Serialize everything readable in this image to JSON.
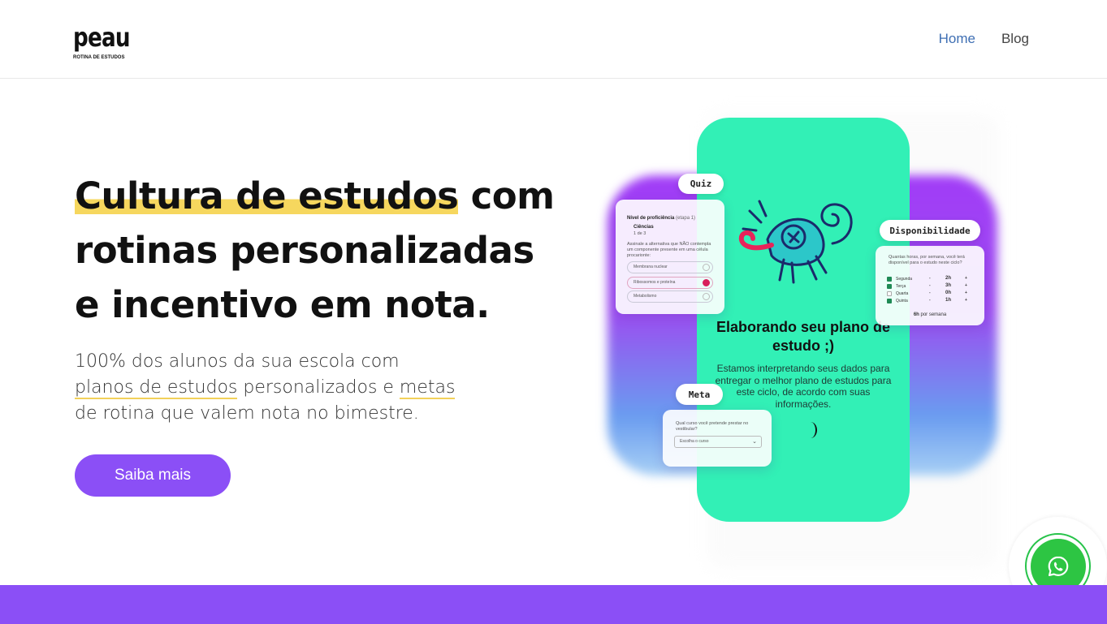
{
  "header": {
    "logo_text": "peau",
    "logo_subtitle": "ROTINA DE ESTUDOS",
    "nav": [
      {
        "label": "Home"
      },
      {
        "label": "Blog"
      }
    ]
  },
  "hero": {
    "headline_highlight": "Cultura de estudos",
    "headline_rest_1": " com",
    "headline_line_2": "rotinas personalizadas",
    "headline_line_3": "e incentivo em nota.",
    "sub_1": "100% dos alunos da sua escola com",
    "sub_link_1": "planos de estudos",
    "sub_2": " personalizados e ",
    "sub_link_2": "metas",
    "sub_3": "de rotina que valem nota no bimestre.",
    "cta_label": "Saiba mais"
  },
  "illustration": {
    "phone_title": "Elaborando seu plano de estudo ;)",
    "phone_text": "Estamos interpretando seus dados para entregar o melhor plano de estudos para este ciclo, de acordo com suas informações.",
    "quiz": {
      "pill": "Quiz",
      "level_label": "Nível de proficiência",
      "level_stage": "(etapa 1)",
      "subject": "Ciências",
      "page": "1 de 3",
      "question": "Assinale a alternativa que NÃO contempla um componente presente em uma célula procarionte:",
      "options": [
        {
          "label": "Membrana nuclear",
          "selected": false
        },
        {
          "label": "Ribossomos e proteína",
          "selected": true
        },
        {
          "label": "Metabolismo",
          "selected": false
        }
      ]
    },
    "disponibilidade": {
      "pill": "Disponibilidade",
      "question": "Quantas horas, por semana, você terá disponível para o estudo neste ciclo?",
      "rows": [
        {
          "day": "Segunda",
          "hours": "2h",
          "checked": true
        },
        {
          "day": "Terça",
          "hours": "3h",
          "checked": true
        },
        {
          "day": "Quarta",
          "hours": "0h",
          "checked": false
        },
        {
          "day": "Quinta",
          "hours": "1h",
          "checked": true
        }
      ],
      "total_value": "6h",
      "total_suffix": " por semana"
    },
    "meta": {
      "pill": "Meta",
      "question": "Qual curso você pretende prestar no vestibular?",
      "select_placeholder": "Escolha o curso"
    }
  },
  "whatsapp": {
    "icon": "whatsapp-icon",
    "color": "#2dc543"
  },
  "colors": {
    "accent_purple": "#8b4ff6",
    "phone_green": "#32f0b6",
    "highlight_yellow": "#f6d75e"
  }
}
